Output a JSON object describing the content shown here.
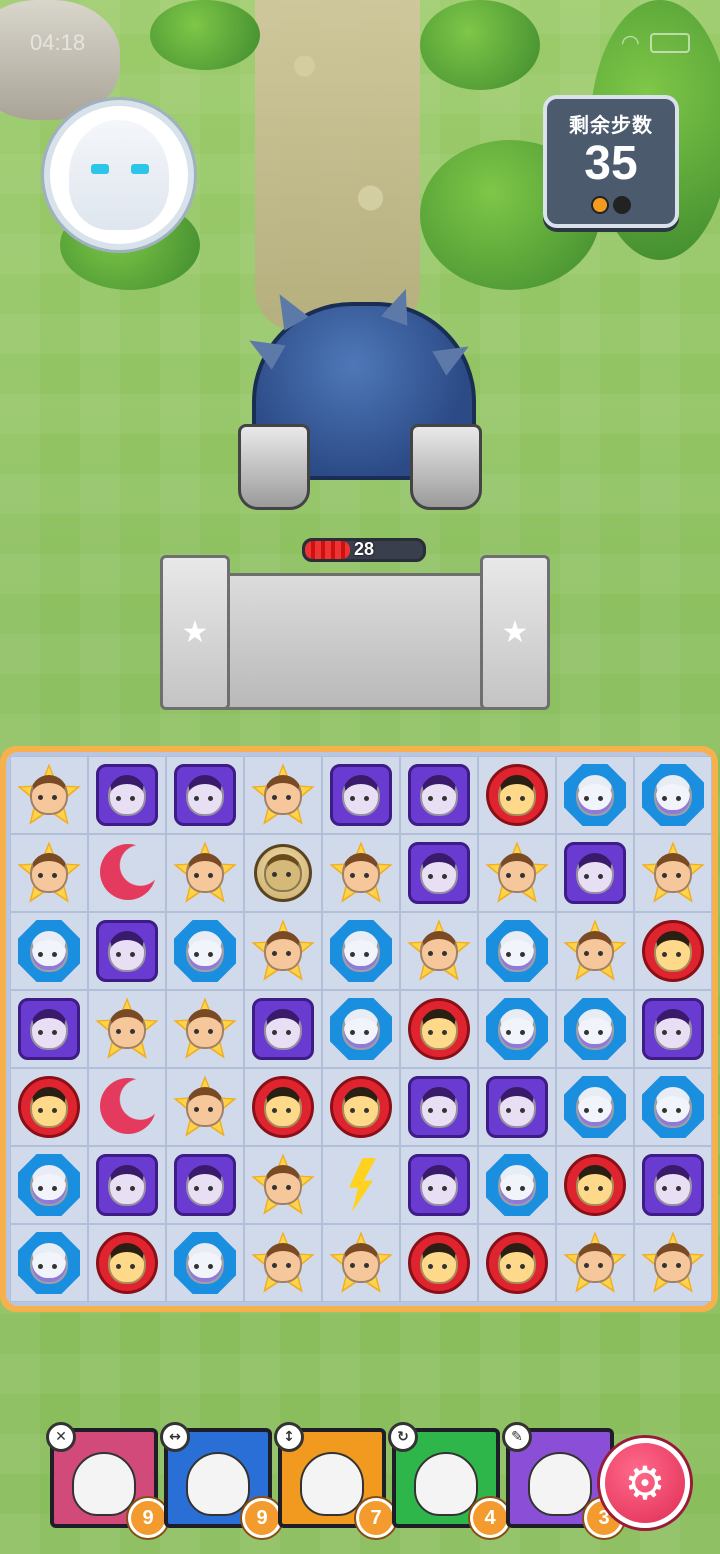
{
  "status_bar": {
    "time": "04:18",
    "signal": "▮▮▮",
    "battery": ""
  },
  "hero": {
    "name": "avatar"
  },
  "steps": {
    "label": "剩余步数",
    "value": "35"
  },
  "boss": {
    "hp": "28",
    "hp_fraction": 0.38
  },
  "board": {
    "rows": [
      [
        "star",
        "purple",
        "purple",
        "star",
        "purple",
        "purple",
        "red",
        "blue",
        "blue"
      ],
      [
        "star",
        "moon",
        "star",
        "helmet",
        "star",
        "purple",
        "star",
        "purple",
        "star"
      ],
      [
        "blue",
        "purple",
        "blue",
        "star",
        "blue",
        "star",
        "blue",
        "star",
        "red"
      ],
      [
        "purple",
        "star",
        "star",
        "purple",
        "blue",
        "red",
        "blue",
        "blue",
        "purple"
      ],
      [
        "red",
        "moon",
        "star",
        "red",
        "red",
        "purple",
        "purple",
        "blue",
        "blue"
      ],
      [
        "blue",
        "purple",
        "purple",
        "star",
        "bolt",
        "purple",
        "blue",
        "red",
        "purple"
      ],
      [
        "blue",
        "red",
        "blue",
        "star",
        "star",
        "red",
        "red",
        "star",
        "star"
      ]
    ]
  },
  "cards": [
    {
      "name": "card-1",
      "count": "9",
      "color": "#d14a7a",
      "badge": "✕"
    },
    {
      "name": "card-2",
      "count": "9",
      "color": "#2a6fd6",
      "badge": "↔"
    },
    {
      "name": "card-3",
      "count": "7",
      "color": "#f29a1f",
      "badge": "↕"
    },
    {
      "name": "card-4",
      "count": "4",
      "color": "#2fb64a",
      "badge": "↻"
    },
    {
      "name": "card-5",
      "count": "3",
      "color": "#8a4fd6",
      "badge": "✎"
    }
  ],
  "settings_icon": "⚙"
}
